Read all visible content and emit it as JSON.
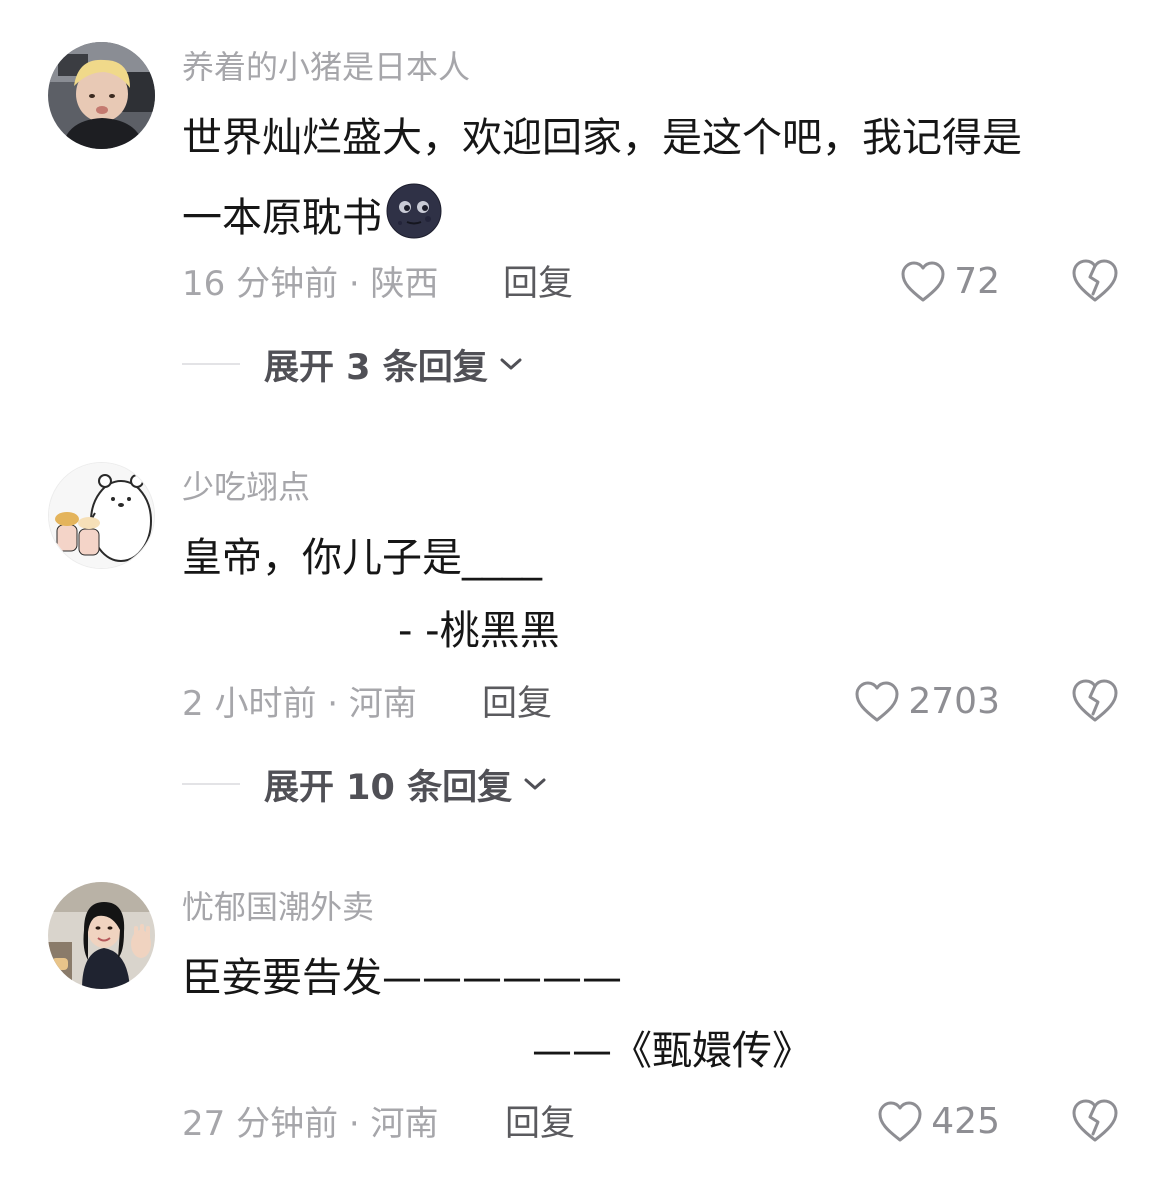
{
  "comments": [
    {
      "username": "养着的小猪是日本人",
      "lines": [
        "世界灿烂盛大，欢迎回家，是这个吧，我记得是",
        "一本原耽书"
      ],
      "emoji": "new-moon-face-emoji",
      "time_location": "16 分钟前 · 陕西",
      "reply_label": "回复",
      "likes": "72",
      "expand_label": "展开 3 条回复"
    },
    {
      "username": "少吃翊点",
      "lines": [
        "皇帝，你儿子是____",
        "- -桃黑黑"
      ],
      "time_location": "2 小时前 · 河南",
      "reply_label": "回复",
      "likes": "2703",
      "expand_label": "展开 10 条回复"
    },
    {
      "username": "忧郁国潮外卖",
      "lines": [
        "臣妾要告发——————",
        "——《甄嬛传》"
      ],
      "time_location": "27 分钟前 · 河南",
      "reply_label": "回复",
      "likes": "425"
    }
  ],
  "icons": {
    "like": "heart-outline-icon",
    "dislike": "broken-heart-icon",
    "expand": "chevron-down-icon"
  },
  "colors": {
    "username": "#a6a6aa",
    "text": "#161616",
    "meta": "#a6a6aa",
    "reply": "#5a5a5e",
    "icon": "#8e8e93"
  }
}
